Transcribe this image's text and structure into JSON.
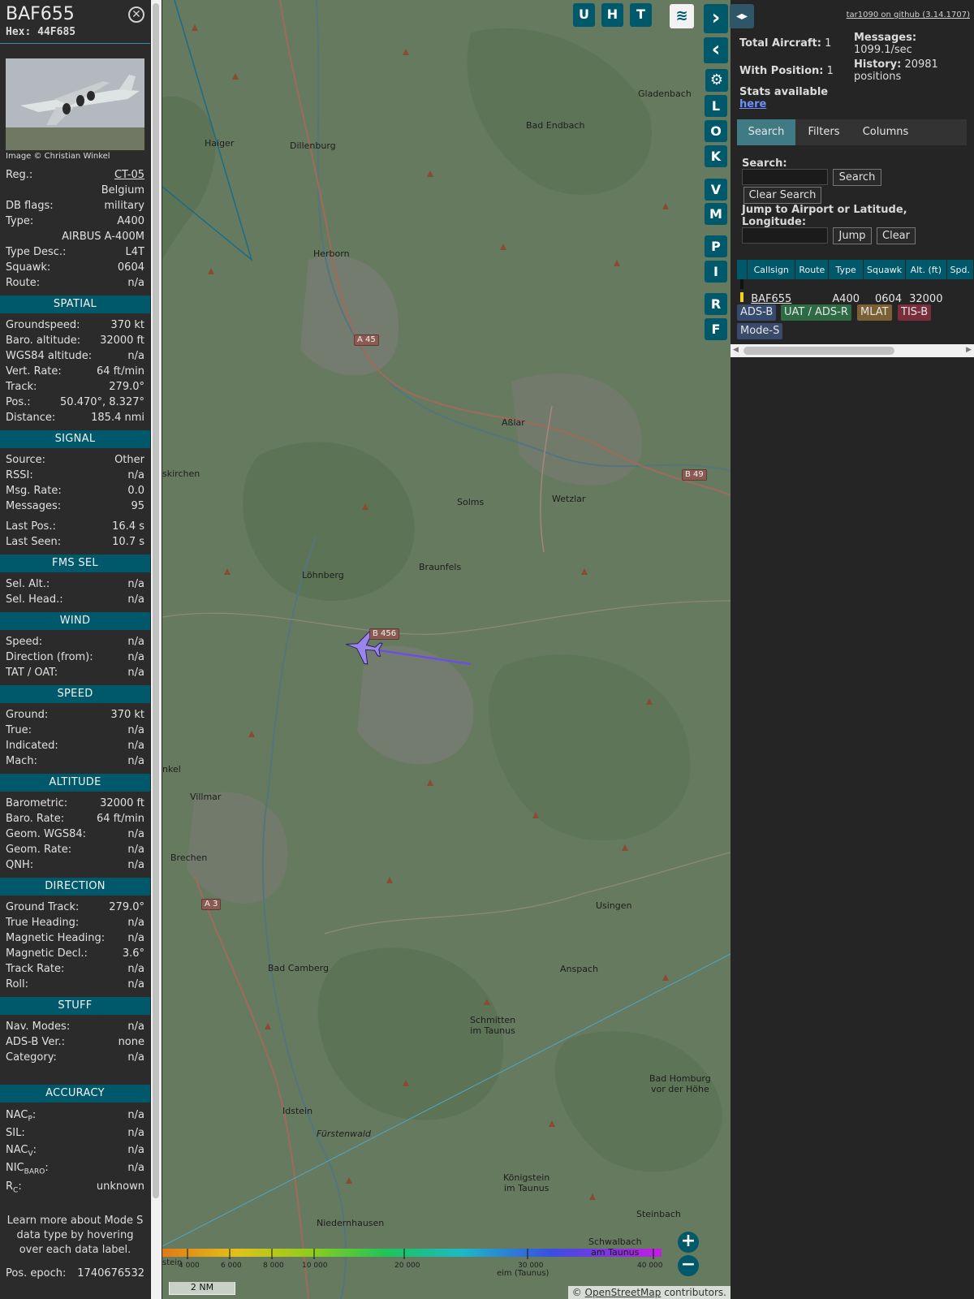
{
  "sidebar": {
    "callsign": "BAF655",
    "hex_label": "Hex:",
    "hex": "44F685",
    "close_icon": "close-icon",
    "photo_credit": "Image © Christian Winkel",
    "basic": [
      {
        "k": "Reg.:",
        "v": "CT-05"
      },
      {
        "k": "",
        "v": "Belgium"
      },
      {
        "k": "DB flags:",
        "v": "military"
      },
      {
        "k": "Type:",
        "v": "A400"
      },
      {
        "k": "",
        "v": "AIRBUS A-400M"
      },
      {
        "k": "Type Desc.:",
        "v": "L4T"
      },
      {
        "k": "Squawk:",
        "v": "0604"
      },
      {
        "k": "Route:",
        "v": "n/a"
      }
    ],
    "sections": {
      "spatial": "SPATIAL",
      "signal": "SIGNAL",
      "fms": "FMS SEL",
      "wind": "WIND",
      "speed": "SPEED",
      "altitude": "ALTITUDE",
      "direction": "DIRECTION",
      "stuff": "STUFF",
      "accuracy": "ACCURACY"
    },
    "spatial": [
      {
        "k": "Groundspeed:",
        "v": "370 kt"
      },
      {
        "k": "Baro. altitude:",
        "v": "32000 ft"
      },
      {
        "k": "WGS84 altitude:",
        "v": "n/a"
      },
      {
        "k": "Vert. Rate:",
        "v": "64 ft/min"
      },
      {
        "k": "Track:",
        "v": "279.0°"
      },
      {
        "k": "Pos.:",
        "v": "50.470°, 8.327°"
      },
      {
        "k": "Distance:",
        "v": "185.4 nmi"
      }
    ],
    "signal": [
      {
        "k": "Source:",
        "v": "Other"
      },
      {
        "k": "RSSI:",
        "v": "n/a"
      },
      {
        "k": "Msg. Rate:",
        "v": "0.0"
      },
      {
        "k": "Messages:",
        "v": "95"
      }
    ],
    "signal2": [
      {
        "k": "Last Pos.:",
        "v": "16.4 s"
      },
      {
        "k": "Last Seen:",
        "v": "10.7 s"
      }
    ],
    "fms": [
      {
        "k": "Sel. Alt.:",
        "v": "n/a"
      },
      {
        "k": "Sel. Head.:",
        "v": "n/a"
      }
    ],
    "wind": [
      {
        "k": "Speed:",
        "v": "n/a"
      },
      {
        "k": "Direction (from):",
        "v": "n/a"
      },
      {
        "k": "TAT / OAT:",
        "v": "n/a"
      }
    ],
    "speed": [
      {
        "k": "Ground:",
        "v": "370 kt"
      },
      {
        "k": "True:",
        "v": "n/a"
      },
      {
        "k": "Indicated:",
        "v": "n/a"
      },
      {
        "k": "Mach:",
        "v": "n/a"
      }
    ],
    "altitude": [
      {
        "k": "Barometric:",
        "v": "32000 ft"
      },
      {
        "k": "Baro. Rate:",
        "v": "64 ft/min"
      },
      {
        "k": "Geom. WGS84:",
        "v": "n/a"
      },
      {
        "k": "Geom. Rate:",
        "v": "n/a"
      },
      {
        "k": "QNH:",
        "v": "n/a"
      }
    ],
    "direction": [
      {
        "k": "Ground Track:",
        "v": "279.0°"
      },
      {
        "k": "True Heading:",
        "v": "n/a"
      },
      {
        "k": "Magnetic Heading:",
        "v": "n/a"
      },
      {
        "k": "Magnetic Decl.:",
        "v": "3.6°"
      },
      {
        "k": "Track Rate:",
        "v": "n/a"
      },
      {
        "k": "Roll:",
        "v": "n/a"
      }
    ],
    "stuff": [
      {
        "k": "Nav. Modes:",
        "v": "n/a"
      },
      {
        "k": "ADS-B Ver.:",
        "v": "none"
      },
      {
        "k": "Category:",
        "v": "n/a"
      }
    ],
    "accuracy": {
      "nacp_k": "NAC",
      "nacp_sub": "P",
      "nacp_v": "n/a",
      "sil_k": "SIL:",
      "sil_v": "n/a",
      "nacv_k": "NAC",
      "nacv_sub": "V",
      "nacv_v": "n/a",
      "nic_k": "NIC",
      "nic_sub": "BARO",
      "nic_v": "n/a",
      "rc_k": "R",
      "rc_sub": "C",
      "rc_v": "unknown"
    },
    "footnote": "Learn more about Mode S data type by hovering over each data label.",
    "epoch_k": "Pos. epoch:",
    "epoch_v": "1740676532"
  },
  "map": {
    "buttons_top": [
      "U",
      "H",
      "T"
    ],
    "buttons_side": [
      "L",
      "O",
      "K",
      "V",
      "M",
      "P",
      "I",
      "R",
      "F"
    ],
    "cities": [
      {
        "name": "Haiger"
      },
      {
        "name": "Dillenburg"
      },
      {
        "name": "Herborn"
      },
      {
        "name": "Bad Endbach"
      },
      {
        "name": "Gladenbach"
      },
      {
        "name": "Aßlar"
      },
      {
        "name": "Wetzlar"
      },
      {
        "name": "Solms"
      },
      {
        "name": "Braunfels"
      },
      {
        "name": "Löhnberg"
      },
      {
        "name": "skirchen"
      },
      {
        "name": "Villmar"
      },
      {
        "name": "nkel"
      },
      {
        "name": "Brechen"
      },
      {
        "name": "Usingen"
      },
      {
        "name": "Bad Camberg"
      },
      {
        "name": "Anspach"
      },
      {
        "name": "Schmitten\nim Taunus"
      },
      {
        "name": "Bad Homburg\nvor der Höhe"
      },
      {
        "name": "Idstein"
      },
      {
        "name": "Fürstenwald"
      },
      {
        "name": "Königstein\nim Taunus"
      },
      {
        "name": "Niedernhausen"
      },
      {
        "name": "Steinbach"
      },
      {
        "name": "Schwalbach\nam Taunus"
      }
    ],
    "roads": [
      "A 45",
      "B 49",
      "B 456",
      "A 3"
    ],
    "scale_labels": [
      "4 000",
      "6 000",
      "8 000",
      "10 000",
      "20 000",
      "30 000",
      "40 000"
    ],
    "scale_left": "stein",
    "scale_mid": "eim (Taunus)",
    "scale_nm": "2 NM",
    "attribution_prefix": "© ",
    "attribution_link": "OpenStreetMap",
    "attribution_suffix": " contributors."
  },
  "panel": {
    "github": "tar1090 on github (3.14.1707)",
    "total_label": "Total Aircraft:",
    "total": "1",
    "messages_label": "Messages:",
    "messages": "1099.1/sec",
    "withpos_label": "With Position:",
    "withpos": "1",
    "history_label": "History:",
    "history": "20981 positions",
    "stats_label": "Stats available",
    "stats_link": "here",
    "tabs": [
      "Search",
      "Filters",
      "Columns"
    ],
    "search_label": "Search:",
    "search_btn": "Search",
    "clear_search_btn": "Clear Search",
    "jump_label": "Jump to Airport or Latitude, Longitude:",
    "jump_btn": "Jump",
    "clear_btn": "Clear",
    "columns": [
      "Callsign",
      "Route",
      "Type",
      "Squawk",
      "Alt. (ft)",
      "Spd."
    ],
    "rows": [
      {
        "callsign": "BAF655",
        "route": "",
        "type": "A400",
        "squawk": "0604",
        "alt": "32000",
        "spd": ""
      }
    ],
    "tags": [
      "ADS-B",
      "UAT / ADS-R",
      "MLAT",
      "TIS-B",
      "Mode-S"
    ],
    "colors": {
      "accent": "#00596b",
      "adsb": "#364a6e",
      "uat": "#2e6b45",
      "mlat": "#7a6032",
      "tisb": "#7a2e3c",
      "modes": "#3a4a6a"
    }
  }
}
